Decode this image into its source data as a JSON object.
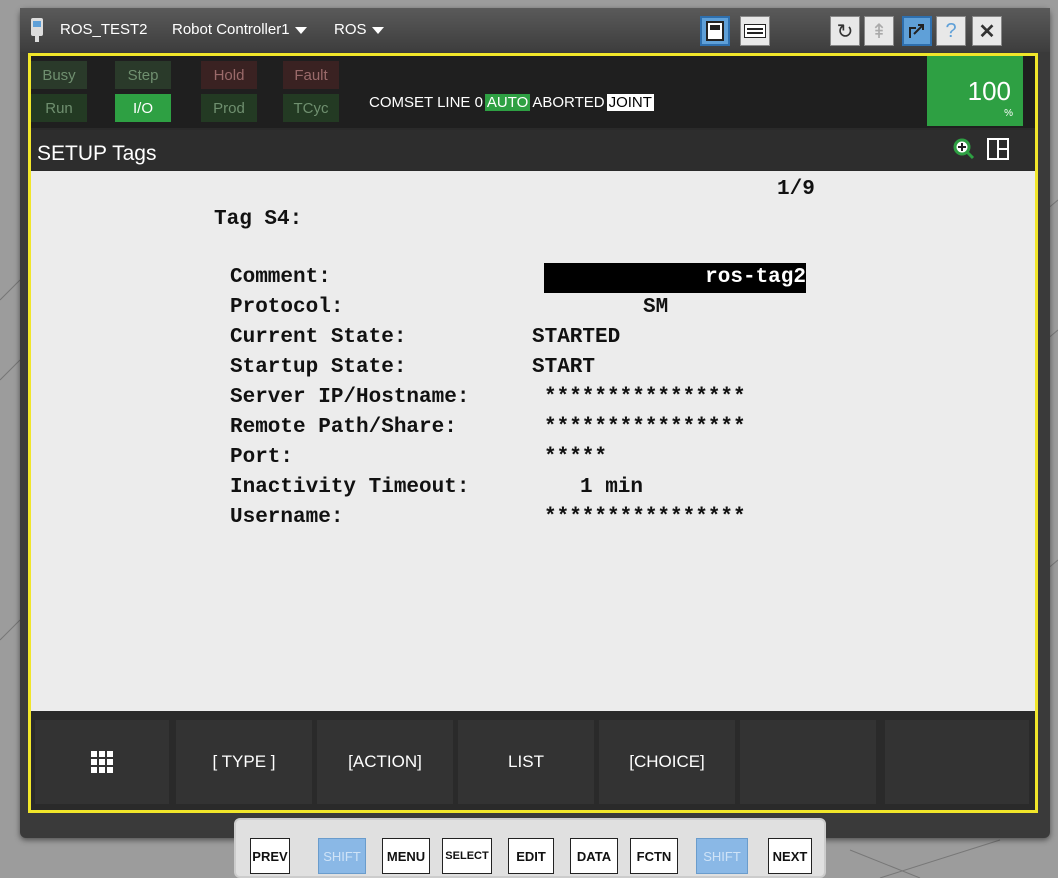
{
  "titlebar": {
    "app": "ROS_TEST2",
    "controller": "Robot Controller1",
    "menu": "ROS"
  },
  "status": {
    "leds": [
      {
        "label": "Busy",
        "on": false
      },
      {
        "label": "Step",
        "on": false
      },
      {
        "label": "Hold",
        "on": false
      },
      {
        "label": "Fault",
        "on": false
      },
      {
        "label": "Run",
        "on": false
      },
      {
        "label": "I/O",
        "on": true
      },
      {
        "label": "Prod",
        "on": false
      },
      {
        "label": "TCyc",
        "on": false
      }
    ],
    "line": {
      "prefix": "COMSET LINE 0",
      "mode": "AUTO",
      "state": "ABORTED",
      "coord": "JOINT"
    },
    "override": {
      "value": "100",
      "unit": "%"
    }
  },
  "screen": {
    "title": "SETUP Tags",
    "page": "1/9",
    "tag_heading": "Tag S4:",
    "fields": [
      {
        "label": "Comment:",
        "value": "ros-tag2"
      },
      {
        "label": "Protocol:",
        "value": "SM"
      },
      {
        "label": "Current State:",
        "value": "STARTED"
      },
      {
        "label": "Startup State:",
        "value": "START"
      },
      {
        "label": "Server IP/Hostname:",
        "value": "****************"
      },
      {
        "label": "Remote Path/Share:",
        "value": "****************"
      },
      {
        "label": "Port:",
        "value": "*****"
      },
      {
        "label": "Inactivity Timeout:",
        "value": "1 min"
      },
      {
        "label": "Username:",
        "value": "****************"
      }
    ]
  },
  "fkeys": [
    "[ TYPE ]",
    "[ACTION]",
    "LIST",
    "[CHOICE]",
    "",
    ""
  ],
  "keys": [
    "PREV",
    "SHIFT",
    "MENU",
    "SELECT",
    "EDIT",
    "DATA",
    "FCTN",
    "SHIFT",
    "NEXT"
  ],
  "colors": {
    "accent_green": "#2ea043",
    "frame_yellow": "#f1e62a"
  }
}
